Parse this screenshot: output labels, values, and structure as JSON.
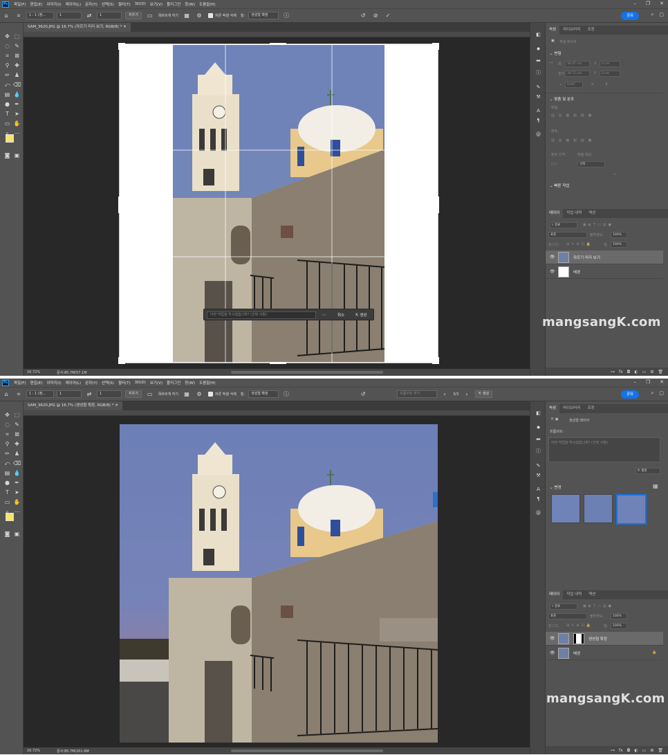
{
  "menu": [
    "파일(F)",
    "편집(E)",
    "이미지(I)",
    "레이어(L)",
    "문자(Y)",
    "선택(S)",
    "필터(T)",
    "3D(D)",
    "보기(V)",
    "플러그인",
    "창(W)",
    "도움말(H)"
  ],
  "options": {
    "ratio": "1 : 1 (정...",
    "ratio2": "1 : 1 (정...",
    "w": "1",
    "h": "1",
    "clear": "지우기",
    "straighten": "똑바르게 하기",
    "delete_crop": "자른 픽셀 삭제",
    "fill_label": "칠:",
    "fill_value": "생성형 확장",
    "share": "공유"
  },
  "shot1": {
    "tab": "SAM_3620.JPG @ 16.7% (자르기 미리 보기, RGB/8) *",
    "zoom": "16.72%",
    "doc": "문서:85.7M/57.1M",
    "prompt_placeholder": "어떤 작업을 하시겠습니까? (선택 사항)",
    "cancel": "취소",
    "generate": "생성",
    "panel_tabs": [
      "속성",
      "라이브러리",
      "조정"
    ],
    "pixel_layer": "픽셀 레이어",
    "transform": "변형",
    "w_label": "폭",
    "h_label": "높이",
    "w_value": "36.47 cm",
    "h_value": "39.71 cm",
    "x_label": "X",
    "y_label": "Y",
    "x_value": "0 cm",
    "y_value": "0 cm",
    "angle": "0.00°",
    "align_head": "맞춤 및 분포",
    "align_sub": "맞춤:",
    "distribute_sub": "분포:",
    "spacing_sub": "분포 간격:",
    "align_to": "맞춤 대상:",
    "align_to_value": "선택",
    "quick_actions": "빠른 작업",
    "layer_tabs": [
      "레이어",
      "작업 내역",
      "액션"
    ],
    "kind": "종류",
    "blend": "표준",
    "opacity_label": "불투명도:",
    "opacity": "100%",
    "lock_label": "잠그기:",
    "fill_label": "칠:",
    "fill": "100%",
    "layers": [
      "자르기 미리 보기",
      "배경"
    ]
  },
  "shot2": {
    "tab": "SAM_3620.JPG @ 16.7% (생성형 확장, RGB/8) *",
    "zoom": "16.72%",
    "doc": "문서:85.7M/201.6M",
    "prompt_placeholder": "프롬프트 추가",
    "variation_counter": "3/3",
    "generate": "생성",
    "panel_tabs": [
      "속성",
      "라이브러리",
      "조정"
    ],
    "gen_layer": "생성형 레이어",
    "prompt_label": "프롬프트:",
    "prompt_area": "어떤 작업을 하시겠습니까? (선택 사항)",
    "generate_btn": "생성",
    "variations_label": "변경",
    "layer_tabs": [
      "레이어",
      "작업 내역",
      "액션"
    ],
    "kind": "종류",
    "blend": "표준",
    "opacity_label": "불투명도:",
    "opacity": "100%",
    "lock_label": "잠그기:",
    "fill_label": "칠:",
    "fill": "100%",
    "layers": [
      "생성형 확장",
      "배경"
    ]
  },
  "watermark": "mangsangK.com",
  "colors": {
    "accent": "#1473e6",
    "foreground_swatch": "#f7e46a",
    "background_swatch": "#ffffff",
    "ui_bg": "#535353",
    "canvas_bg": "#282828"
  }
}
